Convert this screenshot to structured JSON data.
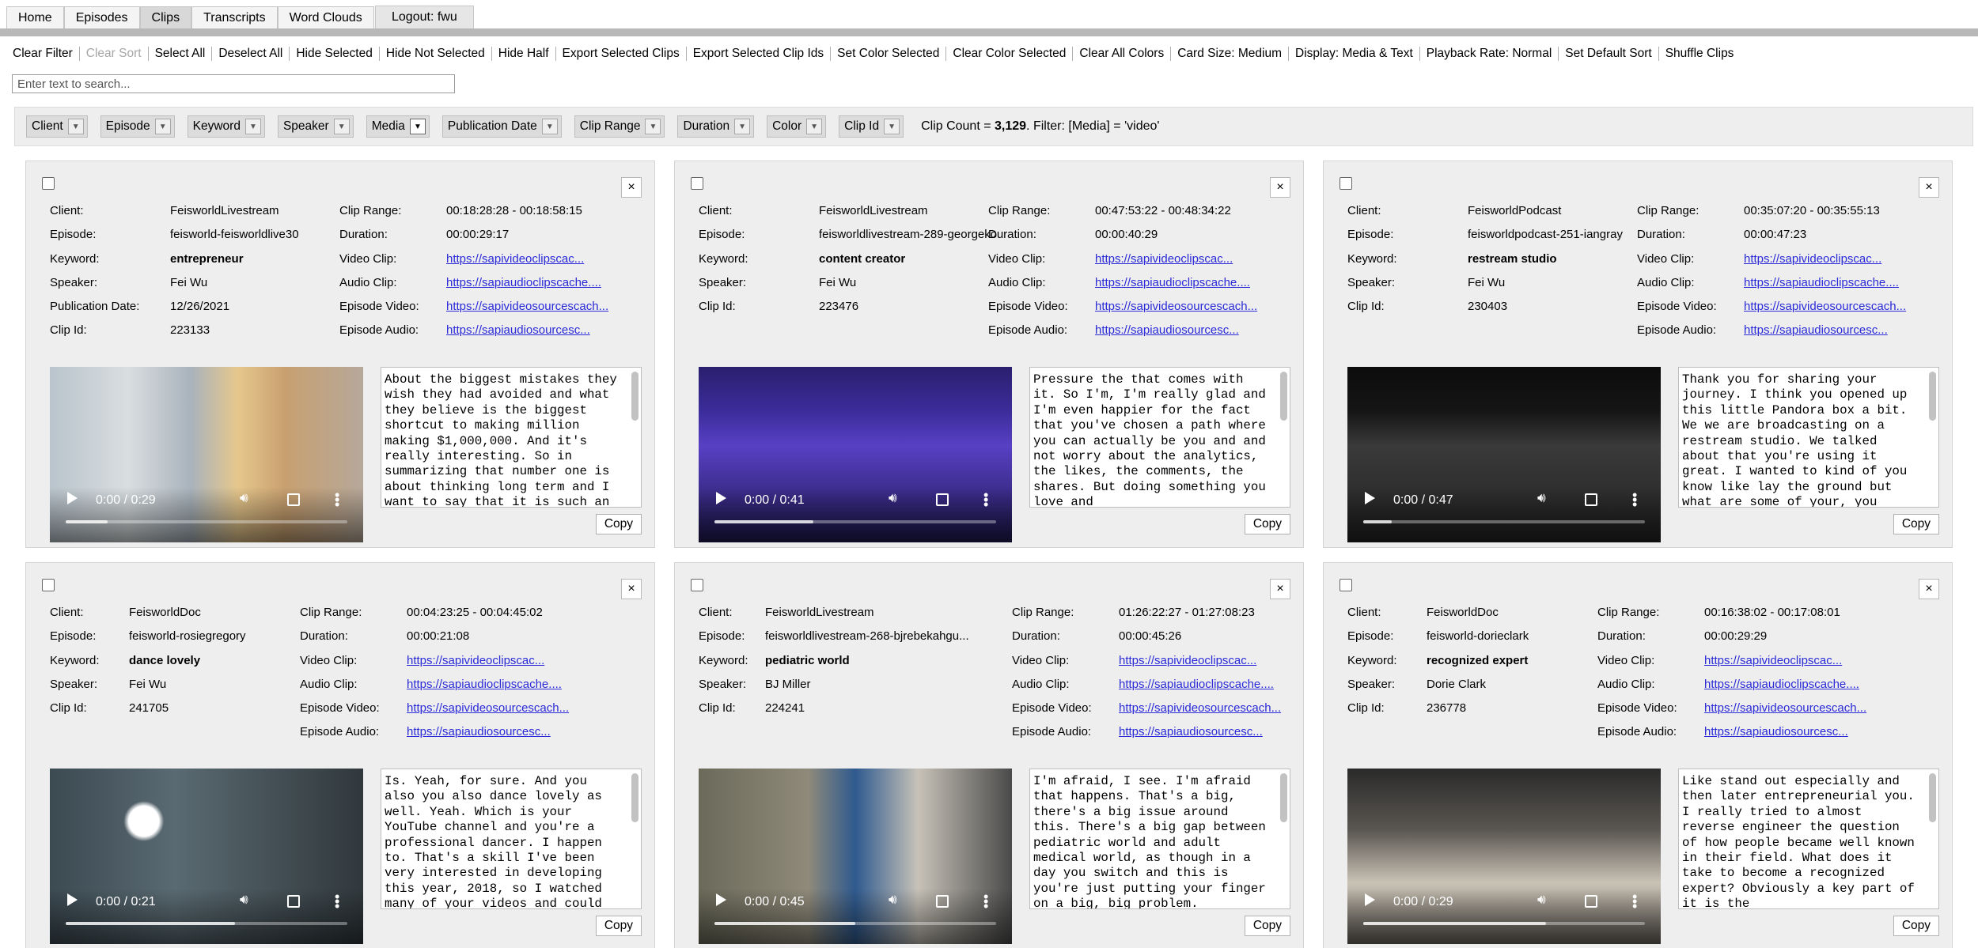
{
  "nav": {
    "tabs": [
      "Home",
      "Episodes",
      "Clips",
      "Transcripts",
      "Word Clouds"
    ],
    "active": "Clips",
    "logout": "Logout: fwu"
  },
  "toolbar": [
    "Clear Filter",
    "Clear Sort",
    "Select All",
    "Deselect All",
    "Hide Selected",
    "Hide Not Selected",
    "Hide Half",
    "Export Selected Clips",
    "Export Selected Clip Ids",
    "Set Color Selected",
    "Clear Color Selected",
    "Clear All Colors",
    "Card Size: Medium",
    "Display: Media & Text",
    "Playback Rate: Normal",
    "Set Default Sort",
    "Shuffle Clips"
  ],
  "toolbar_disabled": [
    "Clear Sort"
  ],
  "search": {
    "placeholder": "Enter text to search...",
    "value": ""
  },
  "filters": [
    "Client",
    "Episode",
    "Keyword",
    "Speaker",
    "Media",
    "Publication Date",
    "Clip Range",
    "Duration",
    "Color",
    "Clip Id"
  ],
  "active_filter": "Media",
  "clip_count": {
    "prefix": "Clip Count = ",
    "count": "3,129",
    "suffix": ". Filter: [Media] = 'video'"
  },
  "labels": {
    "client": "Client:",
    "episode": "Episode:",
    "keyword": "Keyword:",
    "speaker": "Speaker:",
    "publication_date": "Publication Date:",
    "clip_id": "Clip Id:",
    "clip_range": "Clip Range:",
    "duration": "Duration:",
    "video_clip": "Video Clip:",
    "audio_clip": "Audio Clip:",
    "episode_video": "Episode Video:",
    "episode_audio": "Episode Audio:",
    "copy": "Copy"
  },
  "cards": [
    {
      "client": "FeisworldLivestream",
      "episode": "feisworld-feisworldlive30",
      "keyword": "entrepreneur",
      "speaker": "Fei Wu",
      "publication_date": "12/26/2021",
      "clip_id": "223133",
      "clip_range": "00:18:28:28 - 00:18:58:15",
      "duration": "00:00:29:17",
      "video_clip": "https://sapivideoclipscac...",
      "audio_clip": "https://sapiaudioclipscache....",
      "episode_video": "https://sapivideosourcescach...",
      "episode_audio": "https://sapiaudiosourcesc...",
      "time": "0:00 / 0:29",
      "progress": 0.15,
      "transcript": "About the biggest mistakes they wish they had avoided and what they believe is the biggest shortcut to making million making $1,000,000. And it's really interesting. So in summarizing that number one is about thinking long term and I want to say that it is such an"
    },
    {
      "client": "FeisworldLivestream",
      "episode": "feisworldlivestream-289-georgeko",
      "keyword": "content creator",
      "speaker": "Fei Wu",
      "clip_id": "223476",
      "clip_range": "00:47:53:22 - 00:48:34:22",
      "duration": "00:00:40:29",
      "video_clip": "https://sapivideoclipscac...",
      "audio_clip": "https://sapiaudioclipscache....",
      "episode_video": "https://sapivideosourcescach...",
      "episode_audio": "https://sapiaudiosourcesc...",
      "time": "0:00 / 0:41",
      "progress": 0.35,
      "transcript": "Pressure the that comes with it. So I'm, I'm really glad and I'm even happier for the fact that you've chosen a path where you can actually be you and and not worry about the analytics, the likes, the comments, the shares. But doing something you love and"
    },
    {
      "client": "FeisworldPodcast",
      "episode": "feisworldpodcast-251-iangray",
      "keyword": "restream studio",
      "speaker": "Fei Wu",
      "clip_id": "230403",
      "clip_range": "00:35:07:20 - 00:35:55:13",
      "duration": "00:00:47:23",
      "video_clip": "https://sapivideoclipscac...",
      "audio_clip": "https://sapiaudioclipscache....",
      "episode_video": "https://sapivideosourcescach...",
      "episode_audio": "https://sapiaudiosourcesc...",
      "time": "0:00 / 0:47",
      "progress": 0.1,
      "transcript": "Thank you for sharing your journey. I think you opened up this little Pandora box a bit. We we are broadcasting on a restream studio. We talked about that you're using it great. I wanted to kind of you know like lay the ground but what are some of your, you"
    },
    {
      "client": "FeisworldDoc",
      "episode": "feisworld-rosiegregory",
      "keyword": "dance lovely",
      "speaker": "Fei Wu",
      "clip_id": "241705",
      "clip_range": "00:04:23:25 - 00:04:45:02",
      "duration": "00:00:21:08",
      "video_clip": "https://sapivideoclipscac...",
      "audio_clip": "https://sapiaudioclipscache....",
      "episode_video": "https://sapivideosourcescach...",
      "episode_audio": "https://sapiaudiosourcesc...",
      "time": "0:00 / 0:21",
      "progress": 0.6,
      "transcript": "Is. Yeah, for sure. And you also you also dance lovely as well. Yeah. Which is your YouTube channel and you're a professional dancer. I happen to. That's a skill I've been very interested in developing this year, 2018, so I watched many of your videos and could"
    },
    {
      "client": "FeisworldLivestream",
      "episode": "feisworldlivestream-268-bjrebekahgu...",
      "keyword": "pediatric world",
      "speaker": "BJ Miller",
      "clip_id": "224241",
      "clip_range": "01:26:22:27 - 01:27:08:23",
      "duration": "00:00:45:26",
      "video_clip": "https://sapivideoclipscac...",
      "audio_clip": "https://sapiaudioclipscache....",
      "episode_video": "https://sapivideosourcescach...",
      "episode_audio": "https://sapiaudiosourcesc...",
      "time": "0:00 / 0:45",
      "progress": 0.5,
      "transcript": "I'm afraid, I see. I'm afraid that happens. That's a big, there's a big issue around this. There's a big gap between pediatric world and adult medical world, as though in a day you switch and this is you're just putting your finger on a big, big problem."
    },
    {
      "client": "FeisworldDoc",
      "episode": "feisworld-dorieclark",
      "keyword": "recognized expert",
      "speaker": "Dorie Clark",
      "clip_id": "236778",
      "clip_range": "00:16:38:02 - 00:17:08:01",
      "duration": "00:00:29:29",
      "video_clip": "https://sapivideoclipscac...",
      "audio_clip": "https://sapiaudioclipscache....",
      "episode_video": "https://sapivideosourcescach...",
      "episode_audio": "https://sapiaudiosourcesc...",
      "time": "0:00 / 0:29",
      "progress": 0.65,
      "transcript": "Like stand out especially and then later entrepreneurial you. I really tried to almost reverse engineer the question of how people became well known in their field. What does it take to become a recognized expert? Obviously a key part of it is the"
    }
  ]
}
